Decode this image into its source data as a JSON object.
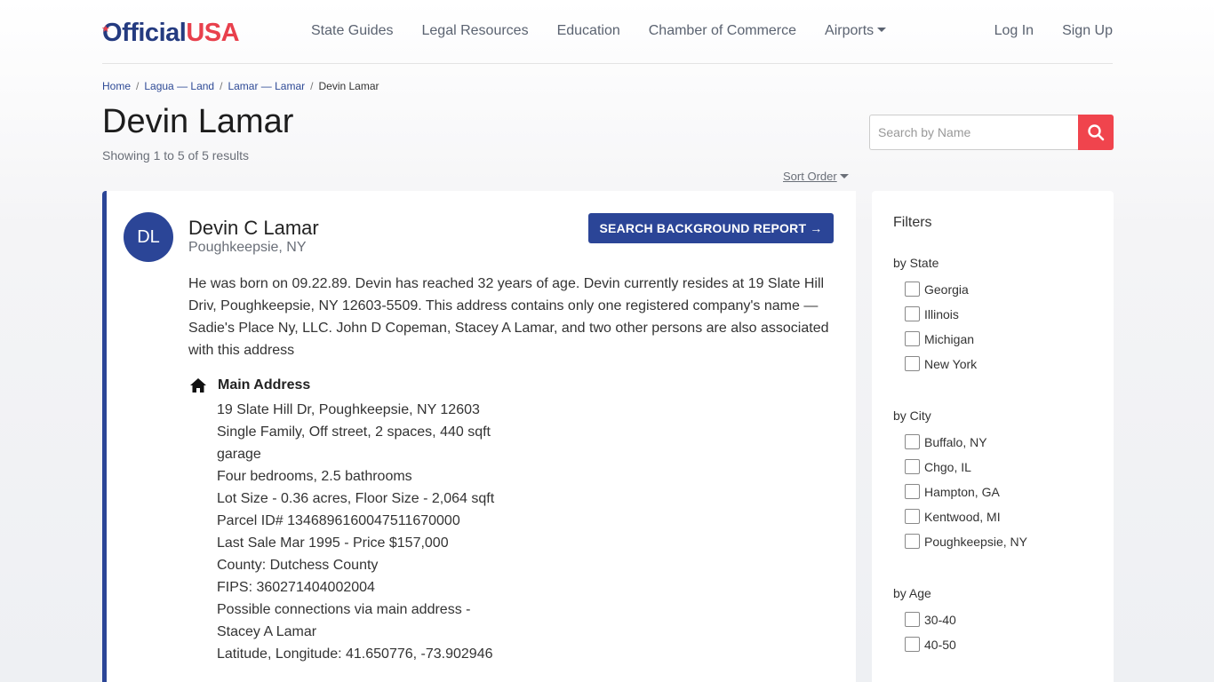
{
  "header": {
    "logo": {
      "o": "O",
      "official": "fficial",
      "usa": "USA"
    },
    "nav": [
      "State Guides",
      "Legal Resources",
      "Education",
      "Chamber of Commerce",
      "Airports"
    ],
    "login": "Log In",
    "signup": "Sign Up"
  },
  "breadcrumb": [
    "Home",
    "Lagua — Land",
    "Lamar — Lamar",
    "Devin Lamar"
  ],
  "page": {
    "title": "Devin Lamar",
    "results_count": "Showing 1 to 5 of 5 results",
    "sort_label": "Sort Order"
  },
  "search": {
    "placeholder": "Search by Name"
  },
  "result": {
    "initials": "DL",
    "name": "Devin C Lamar",
    "location": "Poughkeepsie, NY",
    "report_button": "SEARCH BACKGROUND REPORT →",
    "description": "He was born on 09.22.89. Devin has reached 32 years of age. Devin currently resides at 19 Slate Hill Driv, Poughkeepsie, NY 12603-5509. This address contains only one registered company's name — Sadie's Place Ny, LLC. John D Copeman, Stacey A Lamar, and two other persons are also associated with this address",
    "address_heading": "Main Address",
    "address_lines": [
      "19 Slate Hill Dr, Poughkeepsie, NY 12603",
      "Single Family, Off street, 2 spaces, 440 sqft",
      "garage",
      "Four bedrooms, 2.5 bathrooms",
      "Lot Size - 0.36 acres, Floor Size - 2,064 sqft",
      "Parcel ID# 1346896160047511670000",
      "Last Sale Mar 1995 - Price $157,000",
      "County: Dutchess County",
      "FIPS: 360271404002004",
      "Possible connections via main address -",
      "Stacey A Lamar",
      "Latitude, Longitude: 41.650776, -73.902946"
    ]
  },
  "filters": {
    "title": "Filters",
    "state": {
      "title": "by State",
      "options": [
        "Georgia",
        "Illinois",
        "Michigan",
        "New York"
      ]
    },
    "city": {
      "title": "by City",
      "options": [
        "Buffalo, NY",
        "Chgo, IL",
        "Hampton, GA",
        "Kentwood, MI",
        "Poughkeepsie, NY"
      ]
    },
    "age": {
      "title": "by Age",
      "options": [
        "30-40",
        "40-50"
      ]
    }
  },
  "colors": {
    "brand_blue": "#2b4597",
    "brand_red": "#f0444d"
  }
}
